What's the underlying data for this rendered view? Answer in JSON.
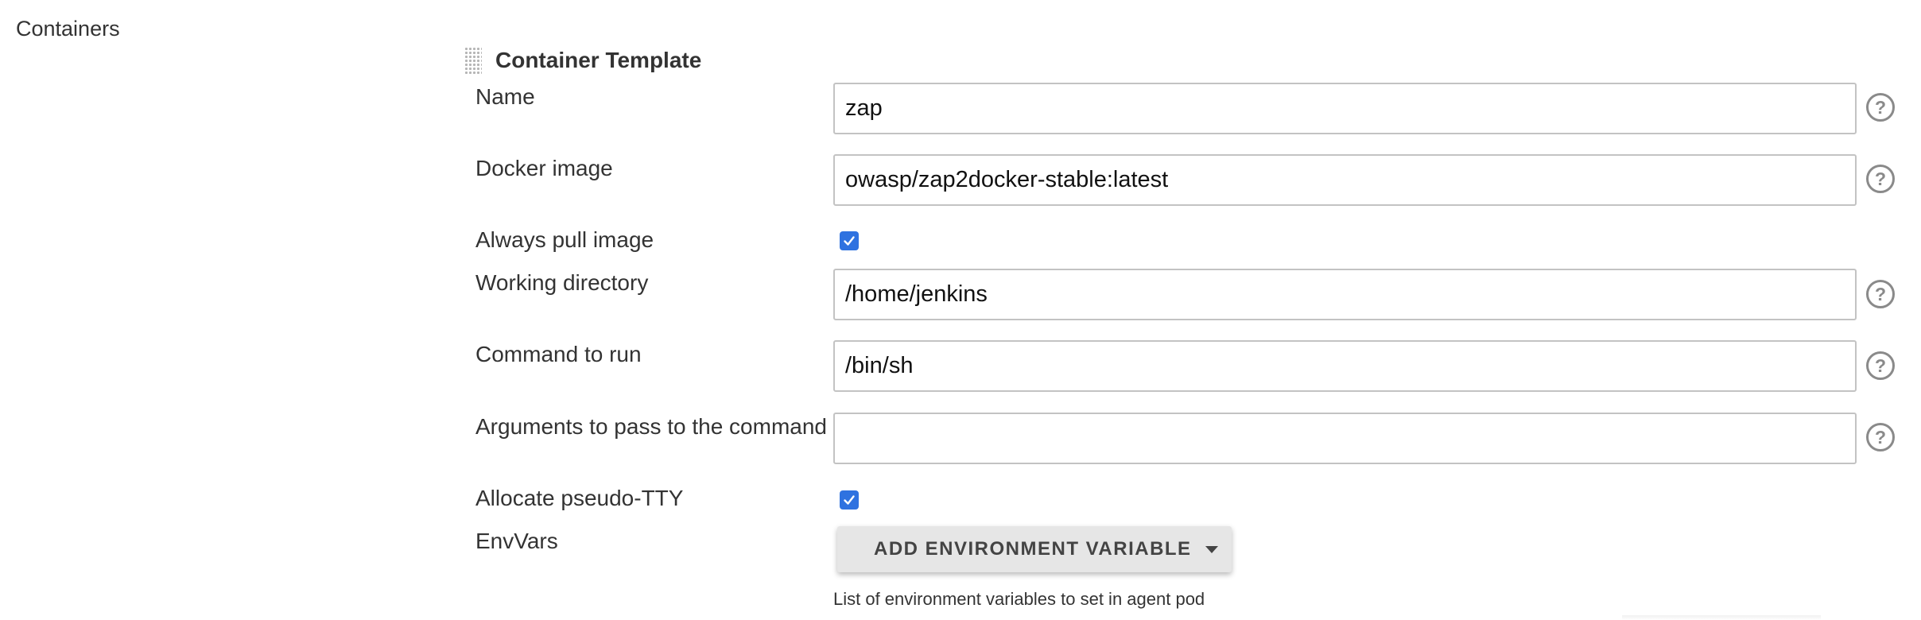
{
  "section": {
    "label": "Containers"
  },
  "container_template": {
    "title": "Container Template",
    "name": {
      "label": "Name",
      "value": "zap"
    },
    "docker_image": {
      "label": "Docker image",
      "value": "owasp/zap2docker-stable:latest"
    },
    "always_pull_image": {
      "label": "Always pull image",
      "checked": true
    },
    "working_directory": {
      "label": "Working directory",
      "value": "/home/jenkins"
    },
    "command_to_run": {
      "label": "Command to run",
      "value": "/bin/sh"
    },
    "arguments": {
      "label": "Arguments to pass to the command",
      "value": ""
    },
    "allocate_tty": {
      "label": "Allocate pseudo-TTY",
      "checked": true
    },
    "envvars": {
      "label": "EnvVars",
      "add_button_label": "ADD ENVIRONMENT VARIABLE",
      "hint": "List of environment variables to set in agent pod"
    }
  },
  "icons": {
    "help": "help-icon",
    "checkbox_check": "check-icon",
    "dropdown": "caret-down-icon",
    "drag": "drag-handle-icon"
  },
  "colors": {
    "checkbox_accent": "#2f72e0",
    "input_border": "#c3c3c3",
    "help_icon": "#8a8a8a",
    "button_bg": "#e6e6e6"
  }
}
